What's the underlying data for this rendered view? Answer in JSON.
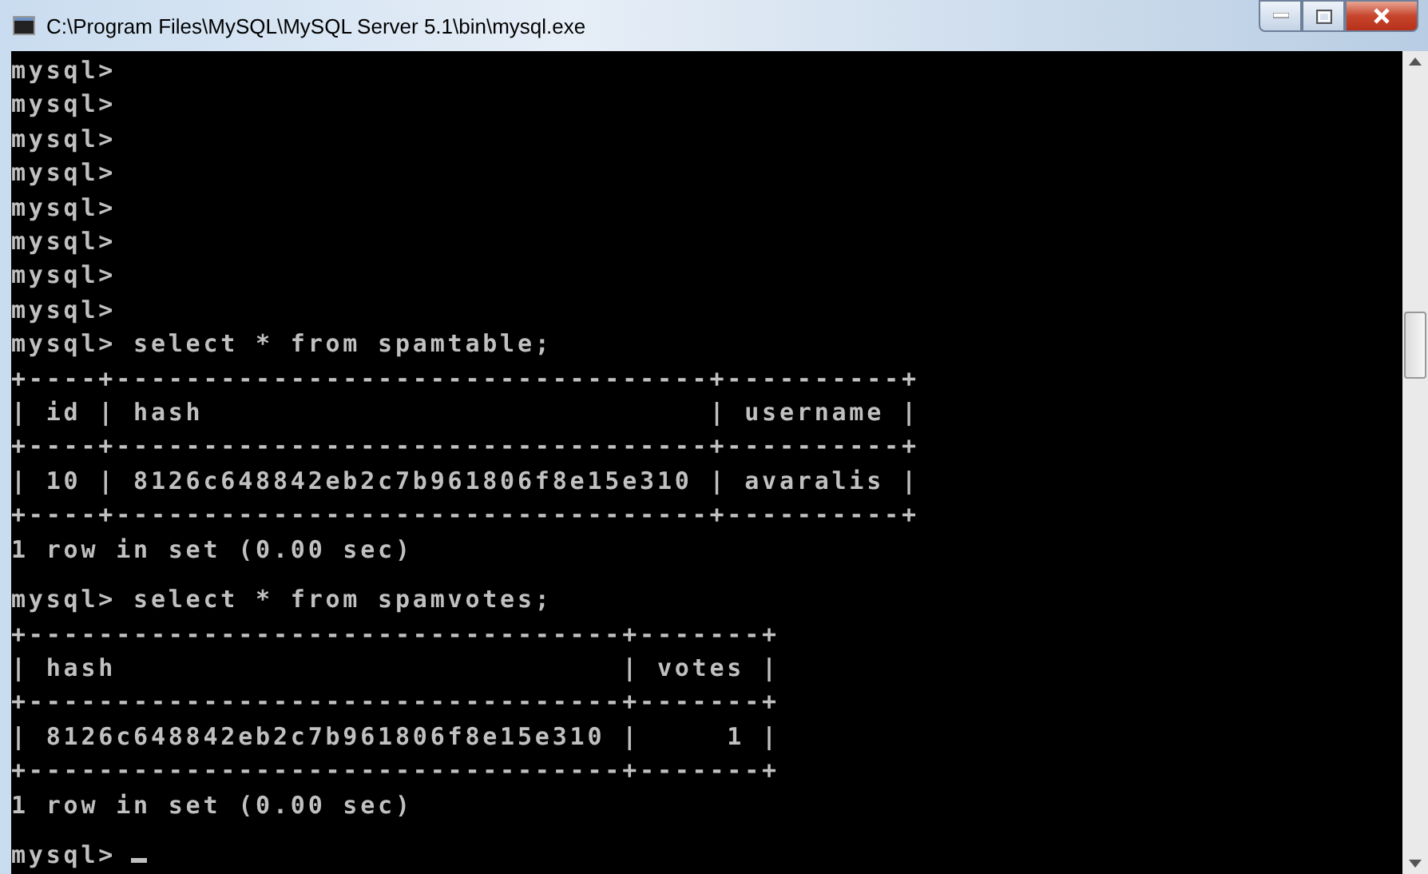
{
  "window": {
    "title": "C:\\Program Files\\MySQL\\MySQL Server 5.1\\bin\\mysql.exe"
  },
  "console": {
    "blocks": [
      {
        "lines": [
          "mysql>",
          "mysql>",
          "mysql>",
          "mysql>",
          "mysql>",
          "mysql>",
          "mysql>",
          "mysql>",
          "mysql> select * from spamtable;",
          "+----+----------------------------------+----------+",
          "| id | hash                             | username |",
          "+----+----------------------------------+----------+",
          "| 10 | 8126c648842eb2c7b961806f8e15e310 | avaralis |",
          "+----+----------------------------------+----------+",
          "1 row in set (0.00 sec)"
        ]
      },
      {
        "lines": [
          "mysql> select * from spamvotes;",
          "+----------------------------------+-------+",
          "| hash                             | votes |",
          "+----------------------------------+-------+",
          "| 8126c648842eb2c7b961806f8e15e310 |     1 |",
          "+----------------------------------+-------+",
          "1 row in set (0.00 sec)"
        ]
      },
      {
        "lines": [
          "mysql>"
        ]
      }
    ]
  }
}
